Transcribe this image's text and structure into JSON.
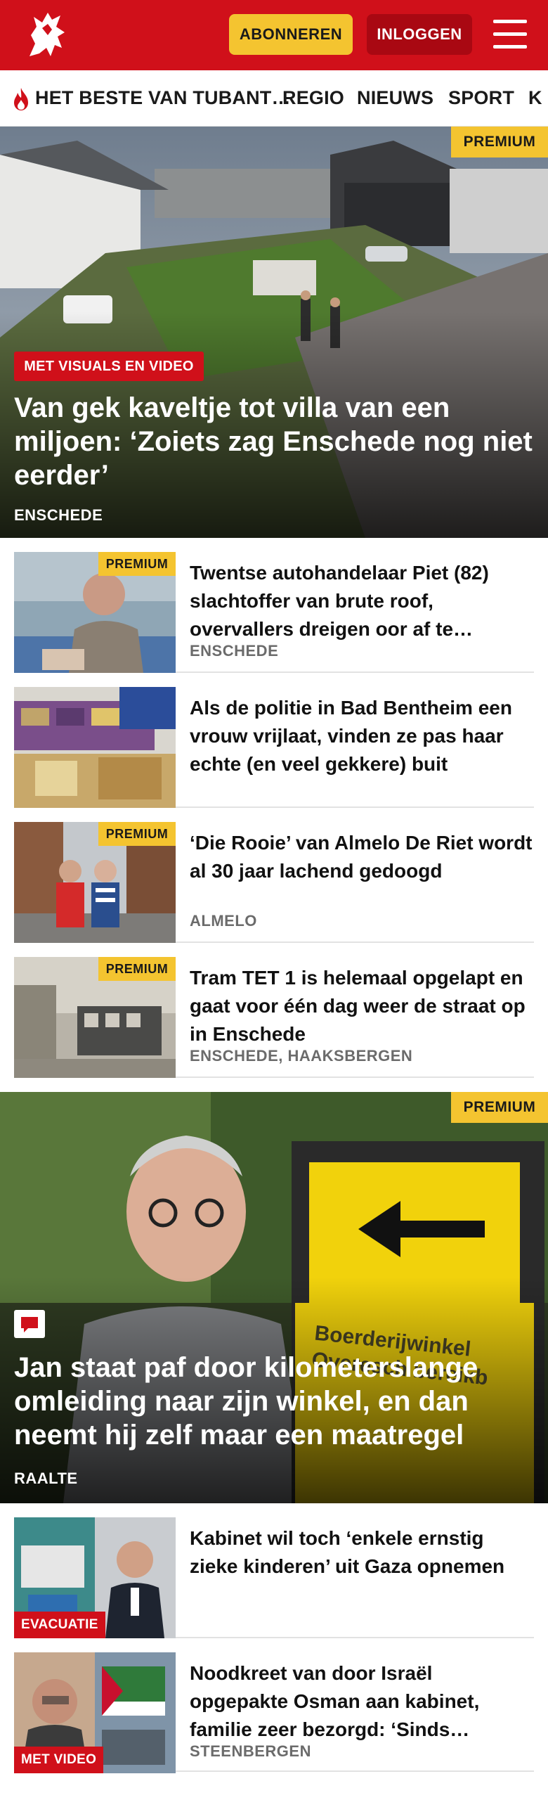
{
  "header": {
    "subscribe_label": "ABONNEREN",
    "login_label": "INLOGGEN",
    "brand_color": "#d0101a",
    "accent_color": "#f4c430"
  },
  "nav": {
    "items": [
      "HET BESTE VAN TUBANT…",
      "REGIO",
      "NIEUWS",
      "SPORT",
      "K"
    ]
  },
  "hero": {
    "badge": "PREMIUM",
    "label": "MET VISUALS EN VIDEO",
    "title": "Van gek kaveltje tot villa van een miljoen: ‘Zoiets zag Enschede nog niet eerder’",
    "location": "ENSCHEDE"
  },
  "articles1": [
    {
      "badge": "PREMIUM",
      "title": "Twentse autohandelaar Piet (82) slachtoffer van brute roof, overvallers dreigen oor af te…",
      "location": "ENSCHEDE"
    },
    {
      "badge": "",
      "title": "Als de politie in Bad Bentheim een vrouw vrijlaat, vinden ze pas haar echte (en veel gekkere) buit",
      "location": ""
    },
    {
      "badge": "PREMIUM",
      "title": "‘Die Rooie’ van Almelo De Riet wordt al 30 jaar lachend gedoogd",
      "location": "ALMELO"
    },
    {
      "badge": "PREMIUM",
      "title": "Tram TET 1 is helemaal opgelapt en gaat voor één dag weer de straat op in Enschede",
      "location": "ENSCHEDE, HAAKSBERGEN"
    }
  ],
  "hero2": {
    "badge": "PREMIUM",
    "title": "Jan staat paf door kilometerslange omleiding naar zijn winkel, en dan neemt hij zelf maar een maatregel",
    "location": "RAALTE",
    "sign_text": "Boerderijwinkel Overesch bereikb"
  },
  "articles2": [
    {
      "label": "EVACUATIE",
      "title": "Kabinet wil toch ‘enkele ernstig zieke kinderen’ uit Gaza opnemen",
      "location": ""
    },
    {
      "label": "MET VIDEO",
      "title": "Noodkreet van door Israël opgepakte Osman aan kabinet, familie zeer bezorgd: ‘Sinds…",
      "location": "STEENBERGEN"
    }
  ]
}
